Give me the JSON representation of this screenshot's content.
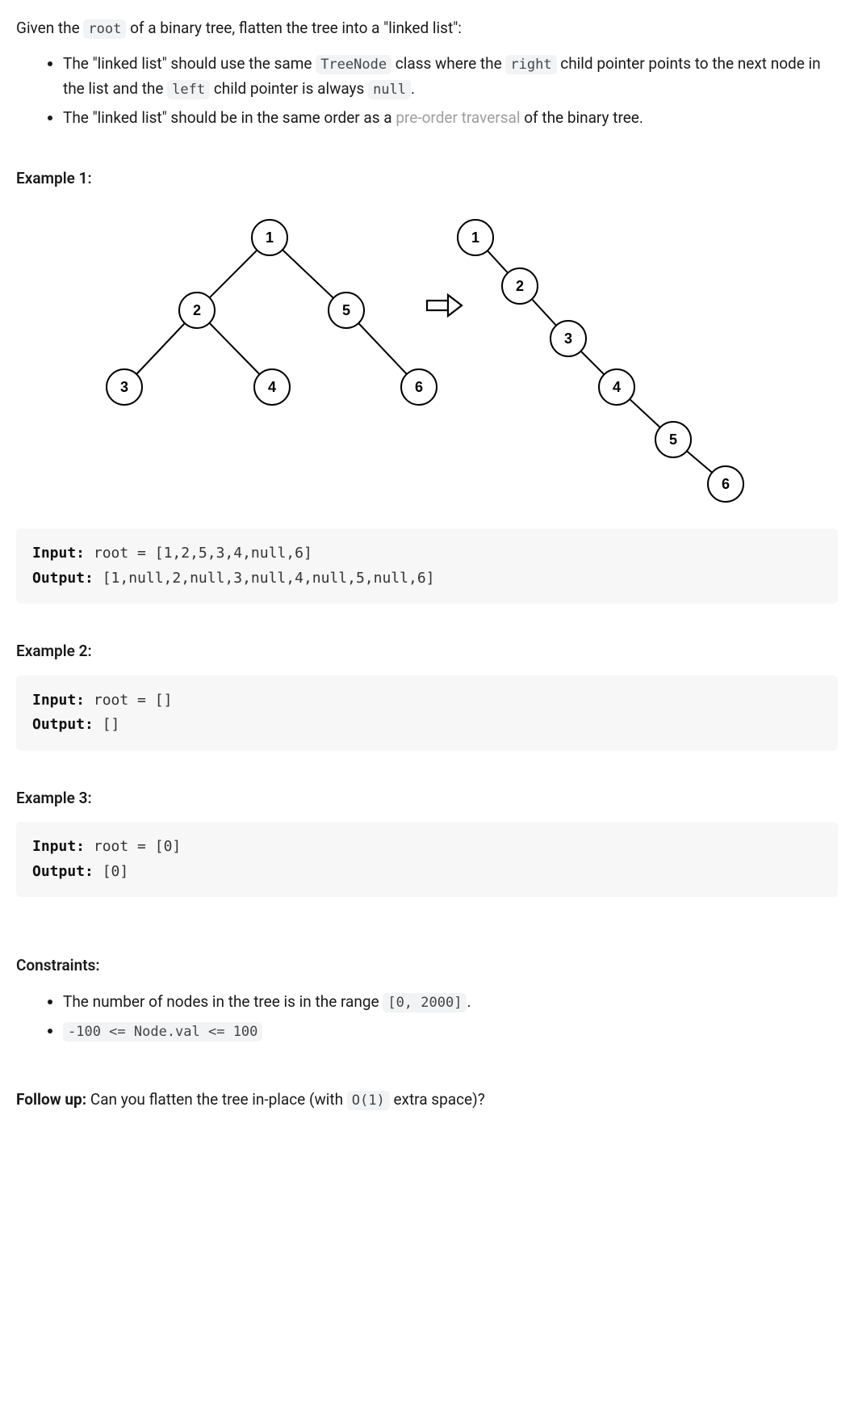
{
  "intro": {
    "pre": "Given the ",
    "code1": "root",
    "post": " of a binary tree, flatten the tree into a \"linked list\":"
  },
  "bullets": [
    {
      "parts": [
        {
          "t": "text",
          "v": "The \"linked list\" should use the same "
        },
        {
          "t": "code",
          "v": "TreeNode"
        },
        {
          "t": "text",
          "v": " class where the "
        },
        {
          "t": "code",
          "v": "right"
        },
        {
          "t": "text",
          "v": " child pointer points to the next node in the list and the "
        },
        {
          "t": "code",
          "v": "left"
        },
        {
          "t": "text",
          "v": " child pointer is always "
        },
        {
          "t": "code",
          "v": "null"
        },
        {
          "t": "text",
          "v": "."
        }
      ]
    },
    {
      "parts": [
        {
          "t": "text",
          "v": "The \"linked list\" should be in the same order as a "
        },
        {
          "t": "link",
          "v": "pre-order traversal"
        },
        {
          "t": "text",
          "v": " of the binary tree."
        }
      ]
    }
  ],
  "example1": {
    "heading": "Example 1:",
    "input_label": "Input:",
    "input_val": " root = [1,2,5,3,4,null,6]",
    "output_label": "Output:",
    "output_val": " [1,null,2,null,3,null,4,null,5,null,6]"
  },
  "example2": {
    "heading": "Example 2:",
    "input_label": "Input:",
    "input_val": " root = []",
    "output_label": "Output:",
    "output_val": " []"
  },
  "example3": {
    "heading": "Example 3:",
    "input_label": "Input:",
    "input_val": " root = [0]",
    "output_label": "Output:",
    "output_val": " [0]"
  },
  "constraints": {
    "heading": "Constraints:",
    "items": [
      {
        "parts": [
          {
            "t": "text",
            "v": "The number of nodes in the tree is in the range "
          },
          {
            "t": "code",
            "v": "[0, 2000]"
          },
          {
            "t": "text",
            "v": "."
          }
        ]
      },
      {
        "parts": [
          {
            "t": "code",
            "v": "-100 <= Node.val <= 100"
          }
        ]
      }
    ]
  },
  "followup": {
    "label": "Follow up:",
    "pre": " Can you flatten the tree in-place (with ",
    "code": "O(1)",
    "post": " extra space)?"
  },
  "diagram": {
    "tree_nodes": [
      "1",
      "2",
      "5",
      "3",
      "4",
      "6"
    ],
    "list_nodes": [
      "1",
      "2",
      "3",
      "4",
      "5",
      "6"
    ],
    "arrow": "⇒"
  }
}
